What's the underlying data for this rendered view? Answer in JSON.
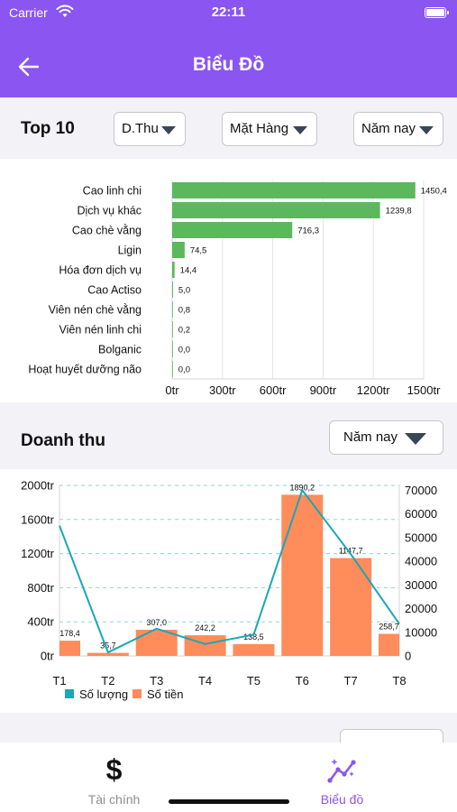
{
  "status_bar": {
    "carrier": "Carrier",
    "time": "22:11"
  },
  "header": {
    "title": "Biểu Đồ",
    "back_icon": "arrow-left-icon"
  },
  "top10": {
    "title": "Top 10",
    "filter_metric": "D.Thu",
    "filter_group": "Mặt Hàng",
    "filter_period": "Năm nay"
  },
  "revenue": {
    "title": "Doanh thu",
    "filter_period": "Năm nay"
  },
  "next_section": {
    "title": "",
    "filter_period": ""
  },
  "tabs": [
    {
      "label": "Tài chính",
      "icon": "dollar-icon",
      "active": false
    },
    {
      "label": "Biểu đồ",
      "icon": "chart-line-icon",
      "active": true
    }
  ],
  "colors": {
    "accent": "#8a55f0",
    "bar_green": "#5cb85c",
    "bar_orange": "#ff8c5a",
    "line_teal": "#1aa7b8"
  },
  "chart_data": [
    {
      "type": "bar",
      "orientation": "horizontal",
      "categories": [
        "Cao linh chi",
        "Dịch vụ khác",
        "Cao chè vằng",
        "Ligin",
        "Hóa đơn dịch vụ",
        "Cao Actiso",
        "Viên nén chè vằng",
        "Viên nén linh chi",
        "Bolganic",
        "Hoạt huyết dưỡng não"
      ],
      "values": [
        1450.4,
        1239.8,
        716.3,
        74.5,
        14.4,
        5.0,
        0.8,
        0.2,
        0.0,
        0.0
      ],
      "value_labels": [
        "1450,4",
        "1239,8",
        "716,3",
        "74,5",
        "14,4",
        "5,0",
        "0,8",
        "0,2",
        "0,0",
        "0,0"
      ],
      "xlim": [
        0,
        1500
      ],
      "x_ticks": [
        0,
        300,
        600,
        900,
        1200,
        1500
      ],
      "x_tick_labels": [
        "0tr",
        "300tr",
        "600tr",
        "900tr",
        "1200tr",
        "1500tr"
      ],
      "grid": "vertical"
    },
    {
      "type": "bar+line",
      "categories": [
        "T1",
        "T2",
        "T3",
        "T4",
        "T5",
        "T6",
        "T7",
        "T8"
      ],
      "series": [
        {
          "name": "Số tiền",
          "type": "bar",
          "axis": "left",
          "values": [
            178.4,
            35.7,
            307.0,
            242.2,
            138.5,
            1890.2,
            1147.7,
            258.7
          ],
          "value_labels": [
            "178,4",
            "35,7",
            "307,0",
            "242,2",
            "138,5",
            "1890,2",
            "1147,7",
            "258,7"
          ]
        },
        {
          "name": "Số lượng",
          "type": "line",
          "axis": "right",
          "values": [
            55000,
            1500,
            11500,
            5000,
            9000,
            70000,
            43000,
            13500
          ]
        }
      ],
      "left_axis": {
        "ylim": [
          0,
          2000
        ],
        "ticks": [
          0,
          400,
          800,
          1200,
          1600,
          2000
        ],
        "tick_labels": [
          "0tr",
          "400tr",
          "800tr",
          "1200tr",
          "1600tr",
          "2000tr"
        ]
      },
      "right_axis": {
        "ylim": [
          0,
          72000
        ],
        "ticks": [
          0,
          10000,
          20000,
          30000,
          40000,
          50000,
          60000,
          70000
        ],
        "tick_labels": [
          "0",
          "10000",
          "20000",
          "30000",
          "40000",
          "50000",
          "60000",
          "70000"
        ]
      },
      "legend": "bottom-left",
      "grid": "horizontal-dashed"
    }
  ]
}
